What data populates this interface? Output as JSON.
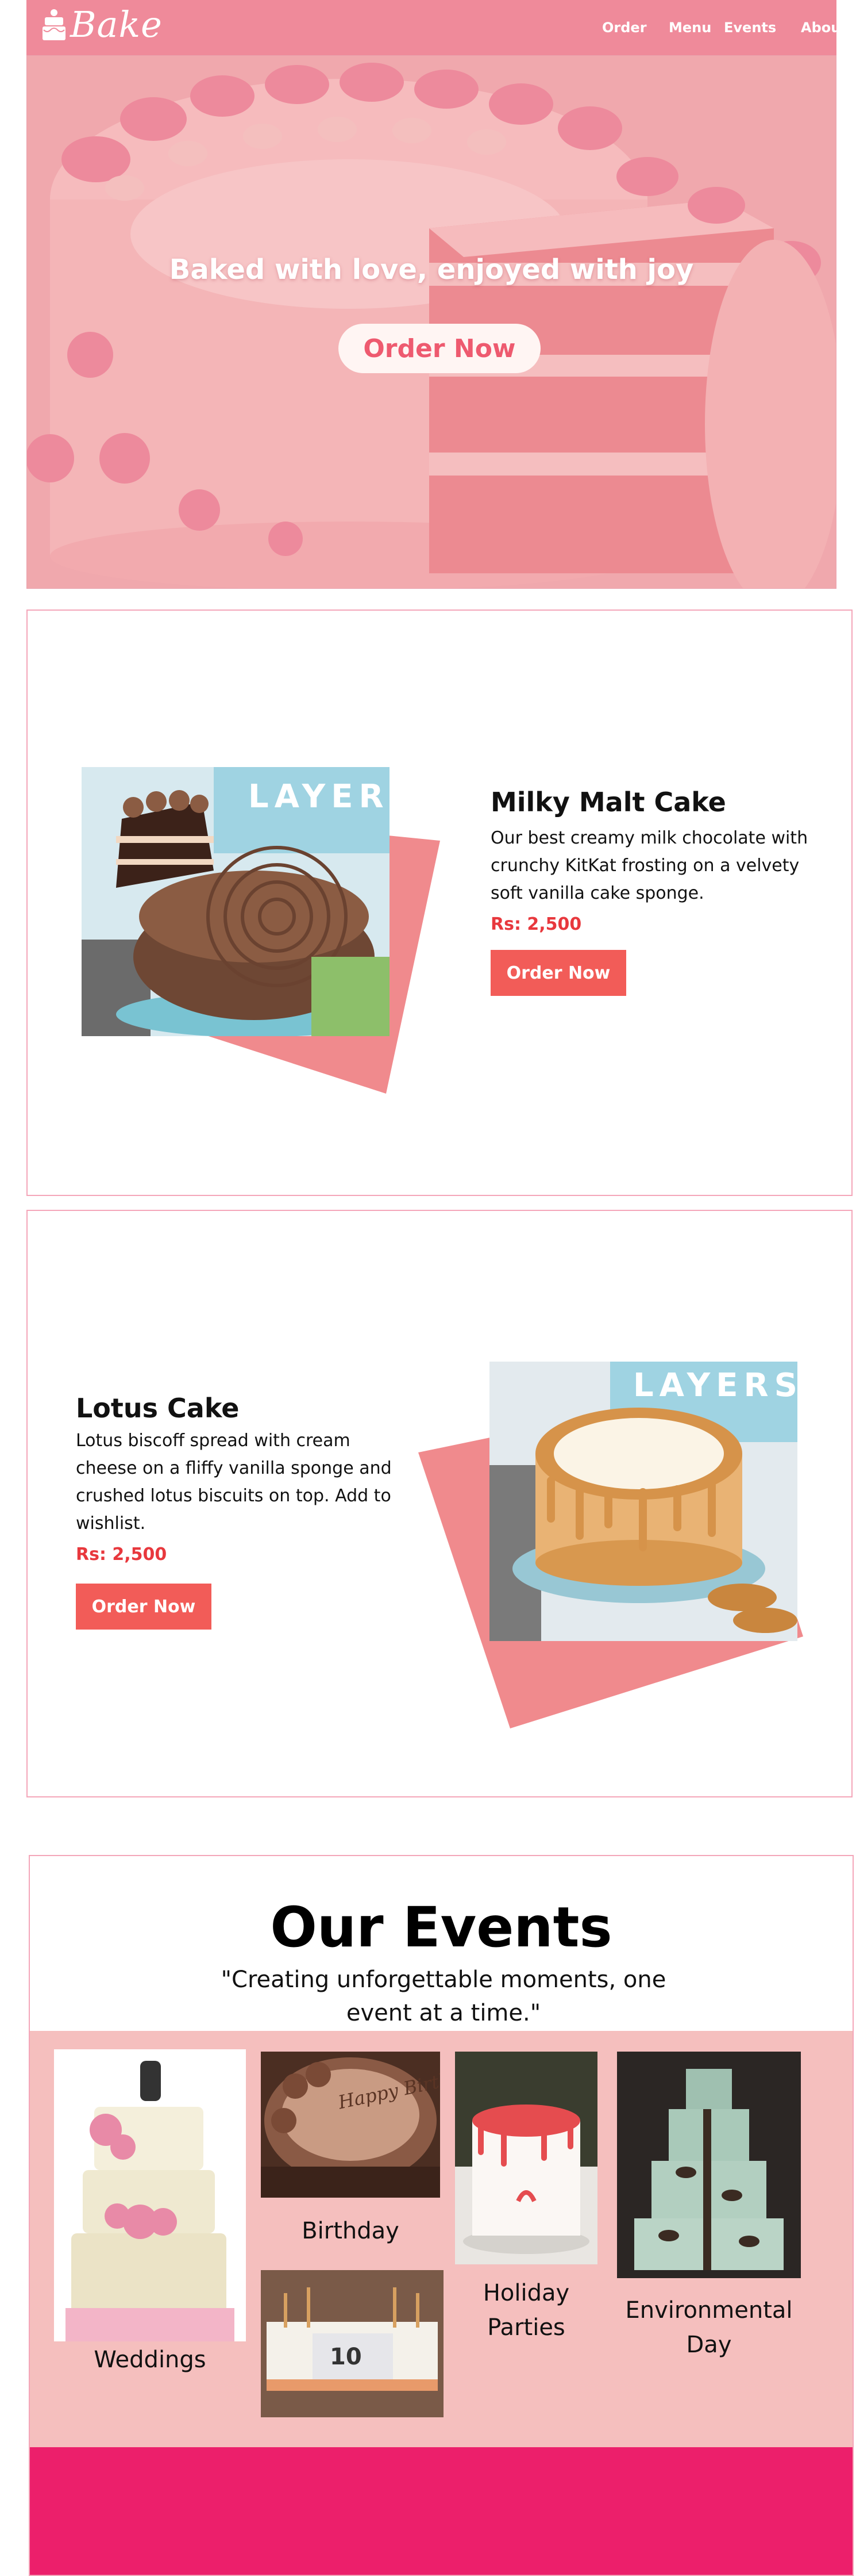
{
  "brand": {
    "name": "Bake"
  },
  "nav": {
    "items": [
      "Order",
      "Menu",
      "Events",
      "About Us"
    ]
  },
  "hero": {
    "title": "Baked with love, enjoyed with joy",
    "button_label": "Order Now"
  },
  "products": [
    {
      "title": "Milky Malt Cake",
      "description": "Our best creamy milk chocolate with crunchy KitKat frosting on a velvety soft vanilla cake sponge.",
      "price": "Rs: 2,500",
      "button_label": "Order Now",
      "sign_text": "LAYERS"
    },
    {
      "title": "Lotus Cake",
      "description": "Lotus biscoff spread with cream cheese on a fliffy vanilla sponge and crushed lotus biscuits on top. Add to wishlist.",
      "price": "Rs: 2,500",
      "button_label": "Order Now",
      "sign_text": "LAYERS"
    }
  ],
  "events": {
    "title": "Our Events",
    "quote": "\"Creating unforgettable moments, one event at a time.\"",
    "items": [
      {
        "label": "Weddings",
        "cake_text": ""
      },
      {
        "label": "Birthday",
        "cake_text": "Happy Birthday"
      },
      {
        "label": "",
        "cake_text": "10"
      },
      {
        "label": "Holiday Parties",
        "cake_text": ""
      },
      {
        "label": "Environmental Day",
        "cake_text": ""
      }
    ]
  },
  "colors": {
    "navbar": "#ef8a9a",
    "accent_red": "#f25c58",
    "price_red": "#e8383d",
    "border_pink": "#f4a6b9",
    "events_panel": "#f5bfbe",
    "footer_magenta": "#ec1f6b"
  }
}
